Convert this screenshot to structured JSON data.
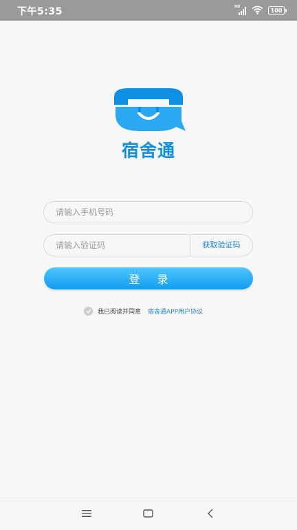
{
  "status_bar": {
    "time": "下午5:35",
    "network": "HD",
    "battery": "100",
    "icons": [
      "signal-icon",
      "wifi-icon",
      "battery-icon"
    ]
  },
  "logo": {
    "app_name": "宿舍通",
    "icon": "phone-smile-icon",
    "color": "#0d8fe2"
  },
  "form": {
    "phone_placeholder": "请输入手机号码",
    "phone_value": "",
    "code_placeholder": "请输入验证码",
    "code_value": "",
    "get_code_label": "获取验证码",
    "login_label": "登 录"
  },
  "agreement": {
    "checked": true,
    "text": "我已阅读并同意",
    "link_text": "宿舍通APP用户协议"
  },
  "nav_bar": {
    "items": [
      "menu-icon",
      "home-icon",
      "back-icon"
    ]
  },
  "colors": {
    "accent": "#1a87d4",
    "button_top": "#4fc6ff",
    "button_bottom": "#129cef",
    "status_bar": "#9a9a9a"
  }
}
